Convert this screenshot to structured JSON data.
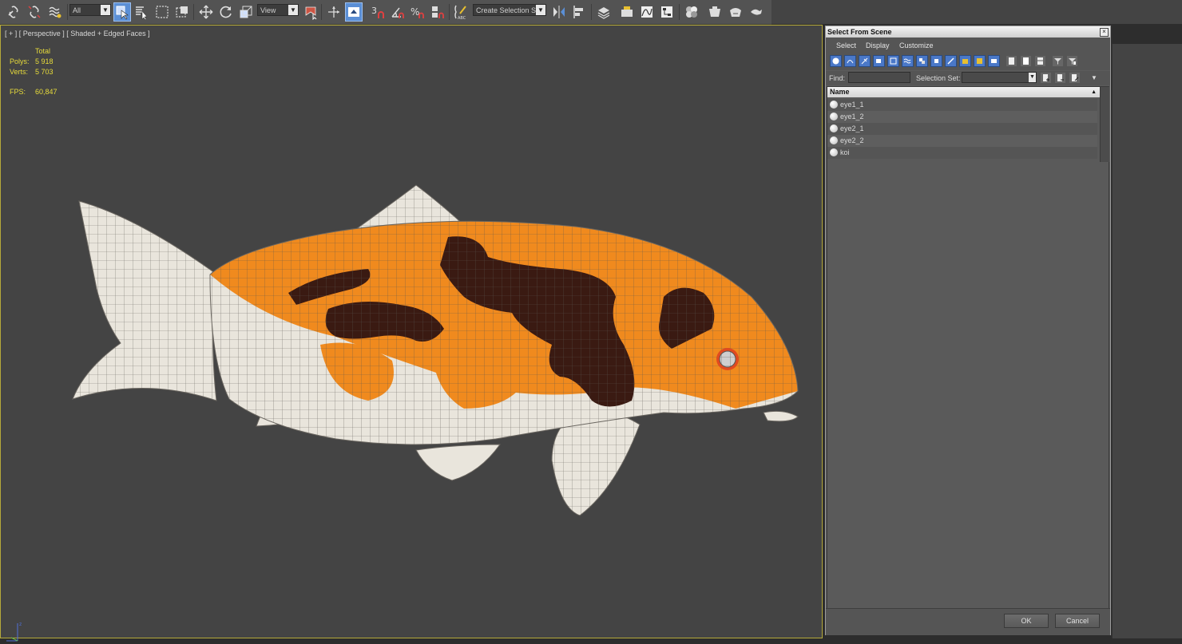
{
  "toolbar": {
    "filter_dropdown": "All",
    "ref_coord_dropdown": "View",
    "snap_label": "3",
    "selection_set_dropdown": "Create Selection Se"
  },
  "viewport": {
    "label": "[ + ] [ Perspective ] [ Shaded + Edged Faces ]",
    "stats": {
      "total_label": "Total",
      "polys_label": "Polys:",
      "polys_value": "5 918",
      "verts_label": "Verts:",
      "verts_value": "5 703",
      "fps_label": "FPS:",
      "fps_value": "60,847"
    },
    "axis_z": "z",
    "fish_colors": {
      "orange": "#f08a1e",
      "black": "#3a1a12",
      "white": "#e9e5dc",
      "mesh": "#6a6660"
    }
  },
  "dialog": {
    "title": "Select From Scene",
    "close_glyph": "×",
    "menu": [
      "Select",
      "Display",
      "Customize"
    ],
    "find_label": "Find:",
    "selection_set_label": "Selection Set:",
    "column_header": "Name",
    "rows": [
      "eye1_1",
      "eye1_2",
      "eye2_1",
      "eye2_2",
      "koi"
    ],
    "ok_label": "OK",
    "cancel_label": "Cancel"
  }
}
